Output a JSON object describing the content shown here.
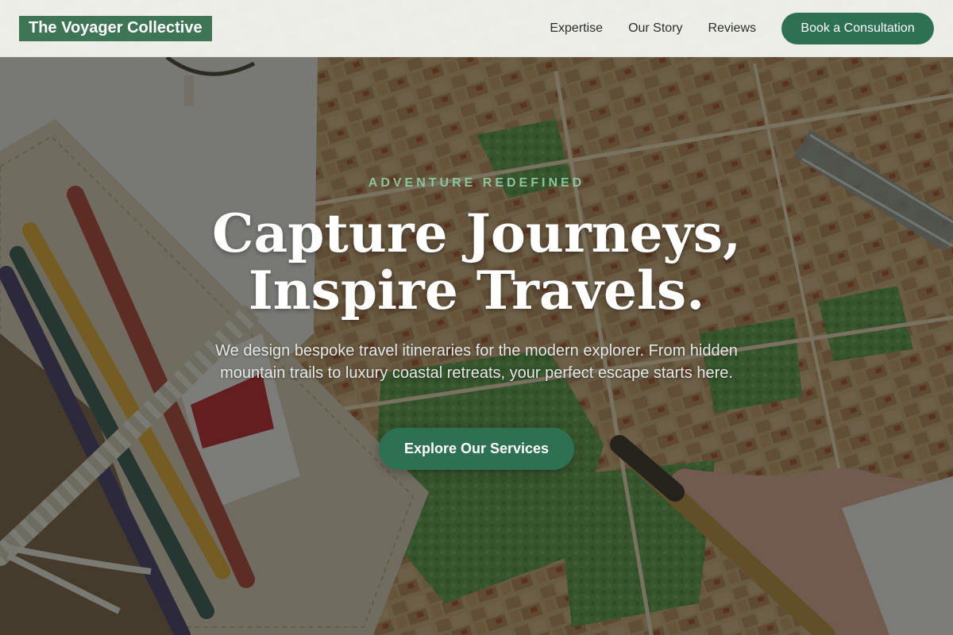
{
  "nav": {
    "brand": "The Voyager Collective",
    "links": [
      "Expertise",
      "Our Story",
      "Reviews"
    ],
    "cta": "Book a Consultation"
  },
  "hero": {
    "eyebrow": "ADVENTURE REDEFINED",
    "headline": "Capture Journeys, Inspire Travels.",
    "subtext": "We design bespoke travel itineraries for the modern explorer. From hidden mountain trails to luxury coastal retreats, your perfect escape starts here.",
    "cta": "Explore Our Services",
    "background_image": "travel-map-with-pencils-and-notebook"
  },
  "colors": {
    "accent_green": "#2e7052",
    "brand_green": "#3d7556",
    "eyebrow_green": "#8cc49b",
    "nav_bg": "#f4f6f1"
  }
}
